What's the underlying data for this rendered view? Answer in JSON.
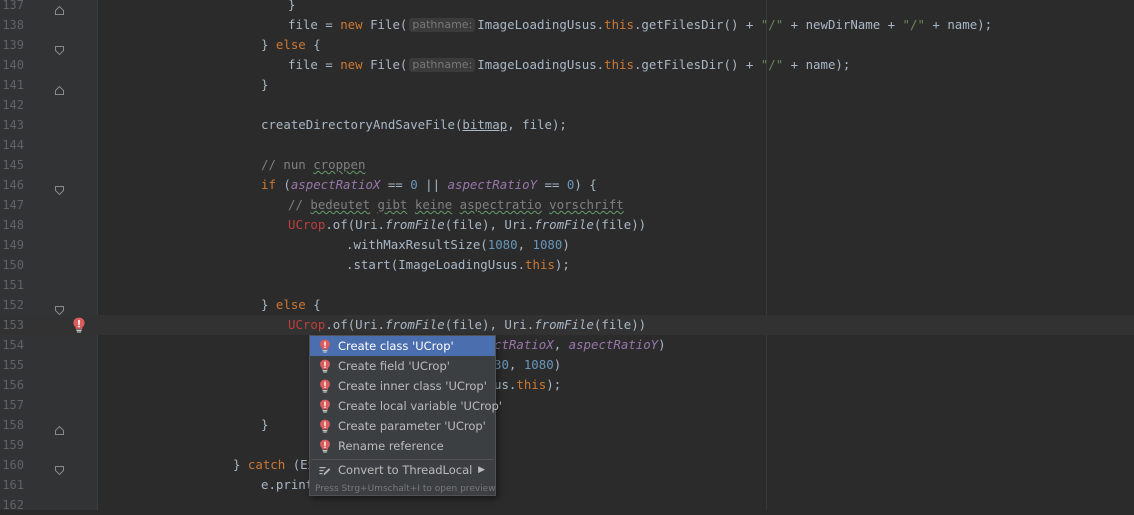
{
  "editor": {
    "lines": [
      {
        "num": "137",
        "indent": 288,
        "fold": "end",
        "tokens": [
          {
            "t": "}",
            "c": ""
          }
        ]
      },
      {
        "num": "138",
        "indent": 288,
        "tokens": [
          {
            "t": "file = ",
            "c": ""
          },
          {
            "t": "new",
            "c": "kw"
          },
          {
            "t": " File(",
            "c": ""
          },
          {
            "hint": "pathname:"
          },
          {
            "t": "ImageLoadingUsus.",
            "c": ""
          },
          {
            "t": "this",
            "c": "kw"
          },
          {
            "t": ".getFilesDir() + ",
            "c": ""
          },
          {
            "t": "\"/\"",
            "c": "str"
          },
          {
            "t": " + newDirName + ",
            "c": ""
          },
          {
            "t": "\"/\"",
            "c": "str"
          },
          {
            "t": " + name);",
            "c": ""
          }
        ]
      },
      {
        "num": "139",
        "indent": 261,
        "fold": "start",
        "tokens": [
          {
            "t": "} ",
            "c": ""
          },
          {
            "t": "else",
            "c": "kw"
          },
          {
            "t": " {",
            "c": ""
          }
        ]
      },
      {
        "num": "140",
        "indent": 288,
        "tokens": [
          {
            "t": "file = ",
            "c": ""
          },
          {
            "t": "new",
            "c": "kw"
          },
          {
            "t": " File(",
            "c": ""
          },
          {
            "hint": "pathname:"
          },
          {
            "t": "ImageLoadingUsus.",
            "c": ""
          },
          {
            "t": "this",
            "c": "kw"
          },
          {
            "t": ".getFilesDir() + ",
            "c": ""
          },
          {
            "t": "\"/\"",
            "c": "str"
          },
          {
            "t": " + name);",
            "c": ""
          }
        ]
      },
      {
        "num": "141",
        "indent": 261,
        "fold": "end",
        "tokens": [
          {
            "t": "}",
            "c": ""
          }
        ]
      },
      {
        "num": "142",
        "indent": 261,
        "tokens": []
      },
      {
        "num": "143",
        "indent": 261,
        "tokens": [
          {
            "t": "createDirectoryAndSaveFile(",
            "c": ""
          },
          {
            "t": "bitmap",
            "c": "ul"
          },
          {
            "t": ", file);",
            "c": ""
          }
        ]
      },
      {
        "num": "144",
        "indent": 261,
        "tokens": []
      },
      {
        "num": "145",
        "indent": 261,
        "tokens": [
          {
            "t": "// nun ",
            "c": "cmt"
          },
          {
            "t": "croppen",
            "c": "cmt spell"
          }
        ]
      },
      {
        "num": "146",
        "indent": 261,
        "fold": "start",
        "tokens": [
          {
            "t": "if",
            "c": "kw"
          },
          {
            "t": " (",
            "c": ""
          },
          {
            "t": "aspectRatioX",
            "c": "fld"
          },
          {
            "t": " == ",
            "c": ""
          },
          {
            "t": "0",
            "c": "num"
          },
          {
            "t": " || ",
            "c": ""
          },
          {
            "t": "aspectRatioY",
            "c": "fld"
          },
          {
            "t": " == ",
            "c": ""
          },
          {
            "t": "0",
            "c": "num"
          },
          {
            "t": ") {",
            "c": ""
          }
        ]
      },
      {
        "num": "147",
        "indent": 288,
        "tokens": [
          {
            "t": "// ",
            "c": "cmt"
          },
          {
            "t": "bedeutet",
            "c": "cmt spell"
          },
          {
            "t": " ",
            "c": "cmt"
          },
          {
            "t": "gibt",
            "c": "cmt spell"
          },
          {
            "t": " ",
            "c": "cmt"
          },
          {
            "t": "keine",
            "c": "cmt spell"
          },
          {
            "t": " ",
            "c": "cmt"
          },
          {
            "t": "aspectratio",
            "c": "cmt spell"
          },
          {
            "t": " ",
            "c": "cmt"
          },
          {
            "t": "vorschrift",
            "c": "cmt spell"
          }
        ]
      },
      {
        "num": "148",
        "indent": 288,
        "tokens": [
          {
            "t": "UCrop",
            "c": "err"
          },
          {
            "t": ".of(Uri.",
            "c": ""
          },
          {
            "t": "fromFile",
            "c": "sm"
          },
          {
            "t": "(file), Uri.",
            "c": ""
          },
          {
            "t": "fromFile",
            "c": "sm"
          },
          {
            "t": "(file))",
            "c": ""
          }
        ]
      },
      {
        "num": "149",
        "indent": 346,
        "tokens": [
          {
            "t": ".withMaxResultSize(",
            "c": ""
          },
          {
            "t": "1080",
            "c": "num"
          },
          {
            "t": ", ",
            "c": ""
          },
          {
            "t": "1080",
            "c": "num"
          },
          {
            "t": ")",
            "c": ""
          }
        ]
      },
      {
        "num": "150",
        "indent": 346,
        "tokens": [
          {
            "t": ".start(ImageLoadingUsus.",
            "c": ""
          },
          {
            "t": "this",
            "c": "kw"
          },
          {
            "t": ");",
            "c": ""
          }
        ]
      },
      {
        "num": "151",
        "indent": 261,
        "tokens": []
      },
      {
        "num": "152",
        "indent": 261,
        "fold": "start",
        "tokens": [
          {
            "t": "} ",
            "c": ""
          },
          {
            "t": "else",
            "c": "kw"
          },
          {
            "t": " {",
            "c": ""
          }
        ]
      },
      {
        "num": "153",
        "indent": 288,
        "current": true,
        "bulb": true,
        "tokens": [
          {
            "t": "UCrop",
            "c": "err"
          },
          {
            "t": ".of(Uri.",
            "c": ""
          },
          {
            "t": "fromFile",
            "c": "sm"
          },
          {
            "t": "(file), Uri.",
            "c": ""
          },
          {
            "t": "fromFile",
            "c": "sm"
          },
          {
            "t": "(file))",
            "c": ""
          }
        ]
      },
      {
        "num": "154",
        "indent": 494,
        "tokens": [
          {
            "t": "ctRatioX",
            "c": "fld"
          },
          {
            "t": ", ",
            "c": ""
          },
          {
            "t": "aspectRatioY",
            "c": "fld"
          },
          {
            "t": ")",
            "c": ""
          }
        ]
      },
      {
        "num": "155",
        "indent": 494,
        "tokens": [
          {
            "t": "30",
            "c": "num"
          },
          {
            "t": ", ",
            "c": ""
          },
          {
            "t": "1080",
            "c": "num"
          },
          {
            "t": ")",
            "c": ""
          }
        ]
      },
      {
        "num": "156",
        "indent": 494,
        "tokens": [
          {
            "t": "us.",
            "c": ""
          },
          {
            "t": "this",
            "c": "kw"
          },
          {
            "t": ");",
            "c": ""
          }
        ]
      },
      {
        "num": "157",
        "indent": 261,
        "tokens": []
      },
      {
        "num": "158",
        "indent": 261,
        "fold": "end",
        "tokens": [
          {
            "t": "}",
            "c": ""
          }
        ]
      },
      {
        "num": "159",
        "indent": 261,
        "tokens": []
      },
      {
        "num": "160",
        "indent": 233,
        "fold": "start",
        "tokens": [
          {
            "t": "} ",
            "c": ""
          },
          {
            "t": "catch",
            "c": "kw"
          },
          {
            "t": " (Ex",
            "c": ""
          }
        ]
      },
      {
        "num": "161",
        "indent": 261,
        "tokens": [
          {
            "t": "e.print",
            "c": ""
          }
        ]
      },
      {
        "num": "162",
        "indent": 261,
        "tokens": []
      }
    ]
  },
  "popup": {
    "items": [
      {
        "label": "Create class 'UCrop'",
        "icon": "error-bulb-icon",
        "selected": true
      },
      {
        "label": "Create field 'UCrop'",
        "icon": "error-bulb-icon"
      },
      {
        "label": "Create inner class 'UCrop'",
        "icon": "error-bulb-icon"
      },
      {
        "label": "Create local variable 'UCrop'",
        "icon": "error-bulb-icon"
      },
      {
        "label": "Create parameter 'UCrop'",
        "icon": "error-bulb-icon"
      },
      {
        "label": "Rename reference",
        "icon": "error-bulb-icon"
      },
      {
        "label": "Convert to ThreadLocal",
        "icon": "intention-pencil-icon",
        "submenu": true
      }
    ],
    "footer": "Press Strg+Umschalt+I to open preview"
  },
  "colors": {
    "background": "#2b2b2b",
    "gutter": "#313335",
    "keyword": "#cc7832",
    "number": "#6897bb",
    "string": "#6a8759",
    "comment": "#808080",
    "field": "#9876aa",
    "error": "#bc3f3c",
    "selection": "#4b6eaf"
  }
}
